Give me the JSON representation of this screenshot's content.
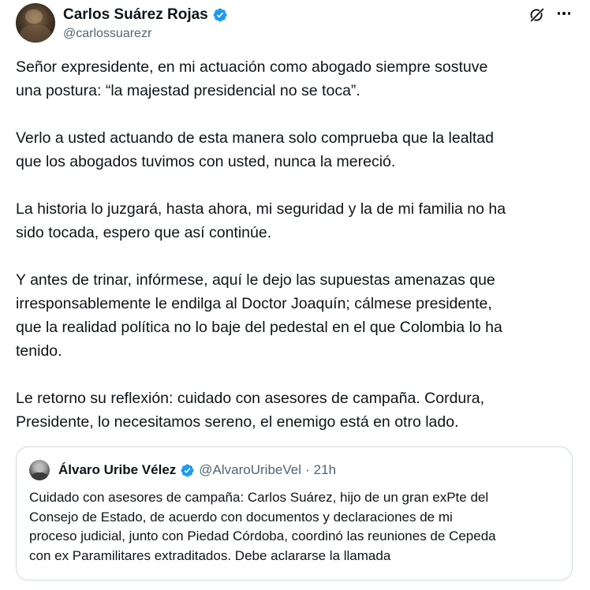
{
  "tweet": {
    "author": {
      "name": "Carlos Suárez Rojas",
      "handle": "@carlossuarezr",
      "verified": true,
      "verified_color": "#1d9bf0"
    },
    "paragraphs": [
      "Señor expresidente, en mi actuación como abogado siempre sostuve\nuna postura: “la majestad presidencial no se toca”.",
      "Verlo a usted actuando de esta manera solo comprueba que la lealtad\nque los abogados tuvimos con usted, nunca la mereció.",
      "La historia lo juzgará, hasta ahora, mi seguridad y la de mi familia no ha\nsido tocada, espero que así continúe.",
      "Y antes de trinar, infórmese, aquí le dejo las supuestas amenazas que\nirresponsablemente le endilga al Doctor Joaquín; cálmese presidente,\nque la realidad política no lo baje del pedestal en el que Colombia lo ha\ntenido.",
      "Le retorno su reflexión: cuidado con asesores de campaña. Cordura,\nPresidente, lo necesitamos sereno, el enemigo está en otro lado."
    ],
    "icons": [
      "grok-icon",
      "more-icon",
      "verified-badge-icon"
    ]
  },
  "quote": {
    "author": {
      "name": "Álvaro Uribe Vélez",
      "handle": "@AlvaroUribeVel",
      "separator": "·",
      "time": "21h",
      "verified": true
    },
    "text": "Cuidado con asesores de campaña: Carlos Suárez, hijo de un gran exPte del\nConsejo de Estado, de acuerdo con documentos y declaraciones de mi\nproceso judicial, junto con Piedad Córdoba, coordinó las reuniones de Cepeda\ncon ex Paramilitares extraditados. Debe aclararse la llamada"
  },
  "colors": {
    "text": "#0f1419",
    "secondary": "#536471",
    "border": "#cfd9de",
    "verified": "#1d9bf0"
  }
}
